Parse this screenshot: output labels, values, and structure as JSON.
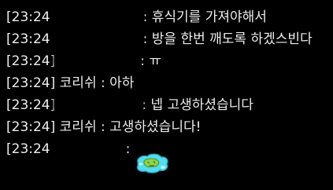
{
  "chat": {
    "lines": [
      {
        "time": "[23:24",
        "message": ": 휴식기를 가져야해서"
      },
      {
        "time": "[23:24",
        "message": ": 방을 한번 깨도록 하겠스빈다"
      },
      {
        "time": "[23:24]",
        "message": ": ㅠ"
      },
      {
        "time": "[23:24]",
        "message": "코리쉬 : 아하"
      },
      {
        "time": "[23:24]",
        "message": ": 넵 고생하셨습니다"
      },
      {
        "time": "[23:24]",
        "message": "코리쉬 : 고생하셨습니다!"
      },
      {
        "time": "[23:24",
        "message": ":"
      }
    ],
    "text_color": "#ededed",
    "background_color": "#000000",
    "sticker_icon": "mint-emote-sticker-icon"
  }
}
